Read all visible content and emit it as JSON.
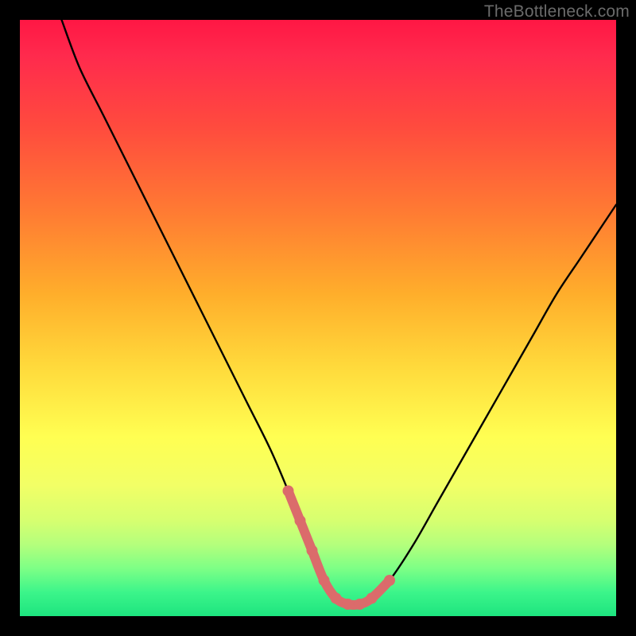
{
  "watermark": "TheBottleneck.com",
  "chart_data": {
    "type": "line",
    "title": "",
    "xlabel": "",
    "ylabel": "",
    "xlim": [
      0,
      100
    ],
    "ylim": [
      0,
      100
    ],
    "series": [
      {
        "name": "bottleneck-curve",
        "x": [
          7,
          10,
          14,
          18,
          22,
          26,
          30,
          34,
          38,
          42,
          45,
          47,
          49,
          51,
          53,
          55,
          57,
          59,
          62,
          66,
          70,
          74,
          78,
          82,
          86,
          90,
          94,
          98,
          100
        ],
        "values": [
          100,
          92,
          84,
          76,
          68,
          60,
          52,
          44,
          36,
          28,
          21,
          16,
          11,
          6,
          3,
          2,
          2,
          3,
          6,
          12,
          19,
          26,
          33,
          40,
          47,
          54,
          60,
          66,
          69
        ]
      }
    ],
    "marker_points": {
      "name": "highlight-markers",
      "x": [
        45,
        47,
        49,
        51,
        53,
        55,
        57,
        59,
        62
      ],
      "y": [
        21,
        16,
        11,
        6,
        3,
        2,
        2,
        3,
        6
      ]
    },
    "background_gradient": {
      "top": "#ff1744",
      "bottom": "#1de47f"
    }
  }
}
